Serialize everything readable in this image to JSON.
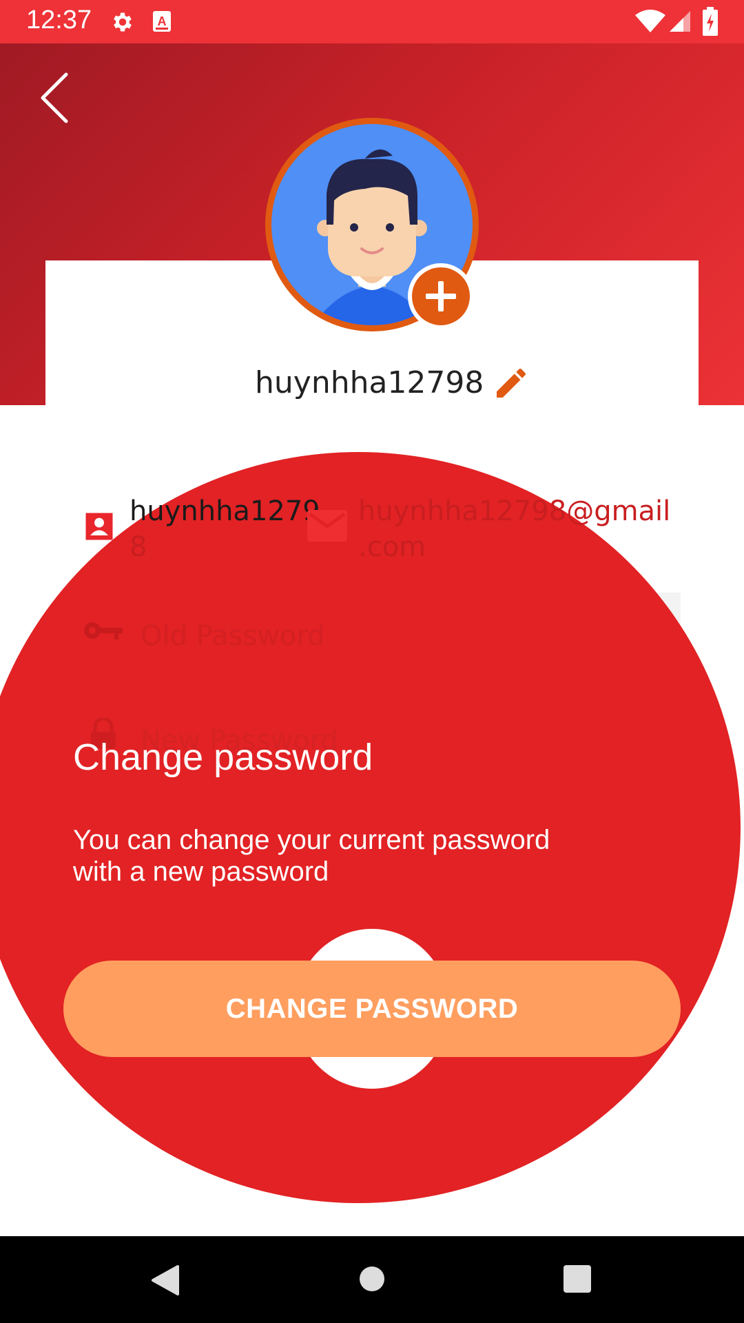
{
  "status_bar": {
    "time": "12:37",
    "icons": [
      "gear-icon",
      "font-a-icon",
      "wifi-icon",
      "signal-icon",
      "battery-icon"
    ]
  },
  "profile": {
    "username": "huynhha12798",
    "avatar_badge_icon": "plus-icon",
    "edit_icon": "pencil-icon"
  },
  "info": {
    "name_line1": "huynhha1279",
    "name_line2": "8",
    "email_line1": "huynhha12798@gmail",
    "email_line2": ".com"
  },
  "fields": {
    "old_password_placeholder": "Old Password",
    "new_password_placeholder": "New Password"
  },
  "tutorial": {
    "title": "Change password",
    "description_line1": "You can change your current password",
    "description_line2": "with a new password"
  },
  "button": {
    "label": "CHANGE PASSWORD"
  },
  "colors": {
    "status_bar": "#EE3237",
    "overlay": "#E22224",
    "button": "#FF9E5F",
    "accent_orange": "#E05A12",
    "icon_red": "#E8262C"
  }
}
